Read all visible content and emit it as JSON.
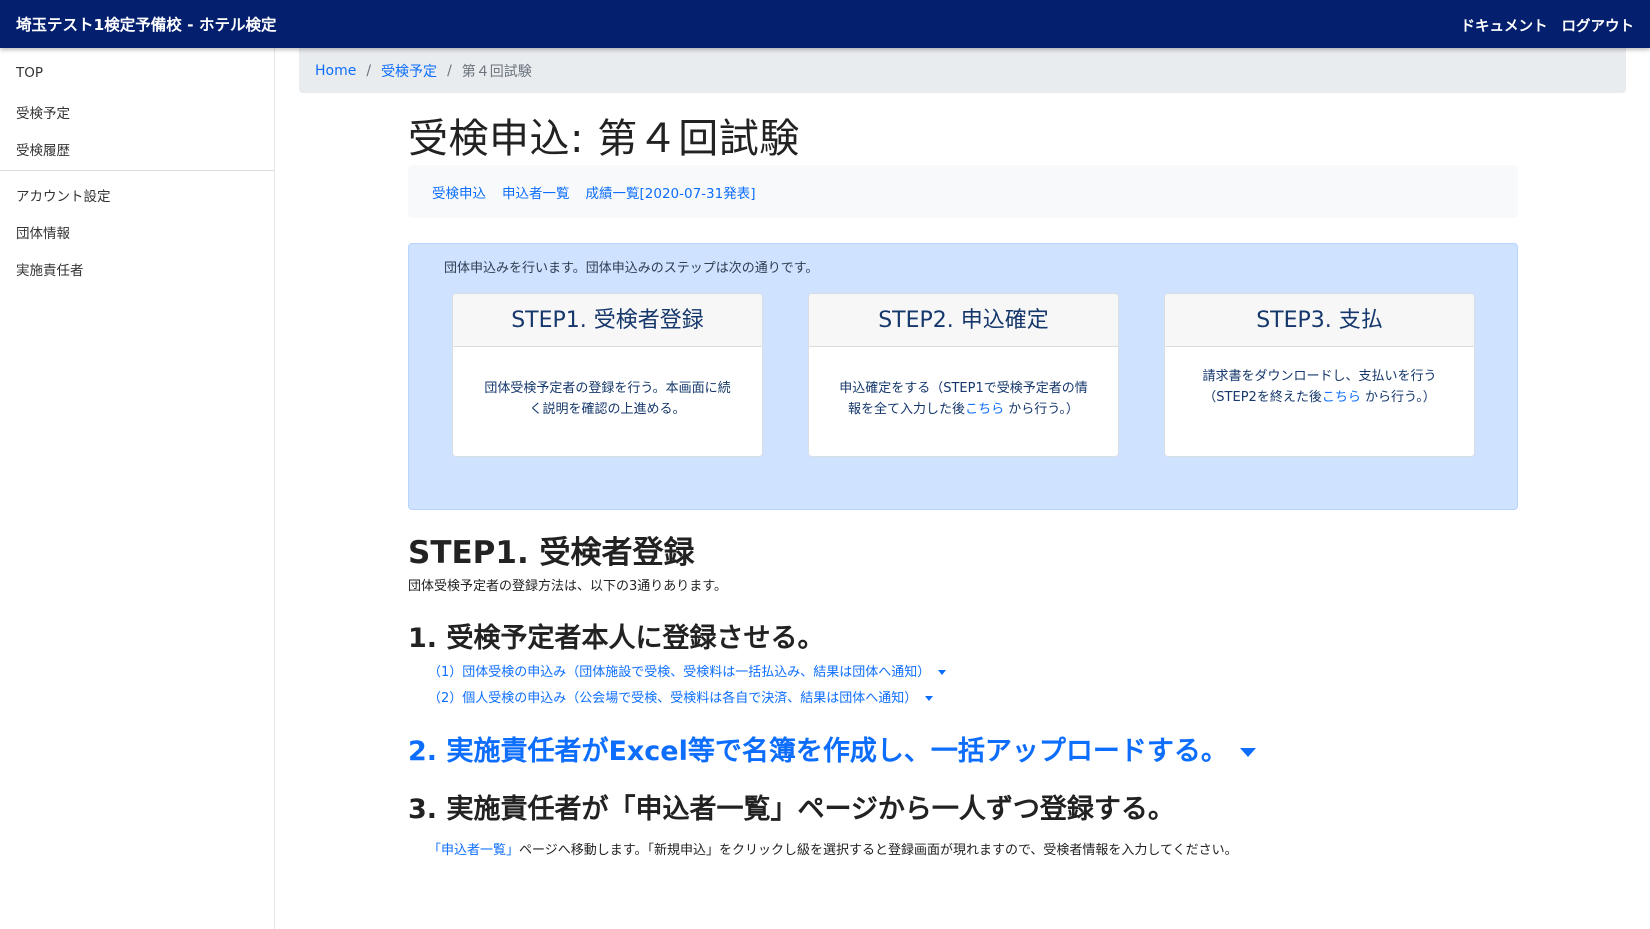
{
  "navbar": {
    "brand": "埼玉テスト1検定予備校 - ホテル検定",
    "links": [
      "ドキュメント",
      "ログアウト"
    ]
  },
  "sidebar": {
    "group1": [
      "TOP",
      "受検予定",
      "受検履歴"
    ],
    "group2": [
      "アカウント設定",
      "団体情報",
      "実施責任者"
    ]
  },
  "breadcrumb": {
    "home": "Home",
    "sep": "/",
    "parent": "受検予定",
    "current": "第４回試験"
  },
  "page_title": "受検申込: 第４回試験",
  "subnav": [
    "受検申込",
    "申込者一覧",
    "成績一覧[2020-07-31発表]"
  ],
  "info": {
    "intro": "団体申込みを行います。団体申込みのステップは次の通りです。",
    "steps": [
      {
        "title": "STEP1. 受検者登録",
        "body_line1": "団体受検予定者の登録を行う。本画面に続",
        "body_line2": "く説明を確認の上進める。"
      },
      {
        "title": "STEP2. 申込確定",
        "body_line1": "申込確定をする（STEP1で受検予定者の情",
        "body_line2_pre": "報を全て入力した後",
        "body_link": "こちら",
        "body_line2_post": " から行う。）"
      },
      {
        "title": "STEP3. 支払",
        "body_line1": "請求書をダウンロードし、支払いを行う",
        "body_line2_pre": "（STEP2を終えた後",
        "body_link": "こちら",
        "body_line2_post": " から行う。）"
      }
    ]
  },
  "section": {
    "title": "STEP1. 受検者登録",
    "desc": "団体受検予定者の登録方法は、以下の3通りあります。",
    "method1": {
      "heading": "1. 受検予定者本人に登録させる。",
      "options": [
        "（1）団体受検の申込み（団体施設で受検、受検料は一括払込み、結果は団体へ通知）",
        "（2）個人受検の申込み（公会場で受検、受検料は各自で決済、結果は団体へ通知）"
      ]
    },
    "method2": {
      "heading": "2. 実施責任者がExcel等で名簿を作成し、一括アップロードする。"
    },
    "method3": {
      "heading": "3. 実施責任者が「申込者一覧」ページから一人ずつ登録する。",
      "desc_link": "「申込者一覧」",
      "desc_rest": "ページへ移動します。「新規申込」をクリックし級を選択すると登録画面が現れますので、受検者情報を入力してください。"
    }
  }
}
